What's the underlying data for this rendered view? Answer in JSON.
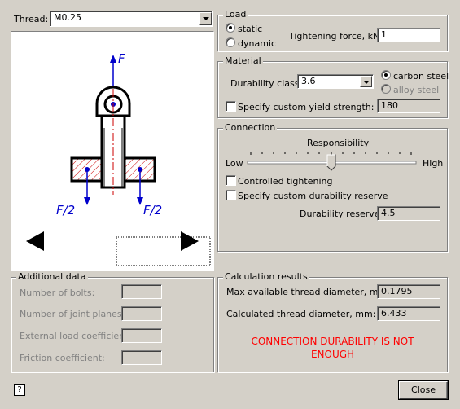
{
  "thread": {
    "label": "Thread:",
    "value": "M0.25"
  },
  "load": {
    "title": "Load",
    "static_label": "static",
    "dynamic_label": "dynamic",
    "selected": "static",
    "force_label": "Tightening force, kN:",
    "force_value": "1"
  },
  "material": {
    "title": "Material",
    "durability_label": "Durability class:",
    "durability_value": "3.6",
    "carbon_label": "carbon steel",
    "alloy_label": "alloy steel",
    "selected": "carbon steel",
    "yield_label": "Specify custom yield strength:",
    "yield_checked": false,
    "yield_value": "180"
  },
  "connection": {
    "title": "Connection",
    "responsibility_label": "Responsibility",
    "low_label": "Low",
    "high_label": "High",
    "controlled_label": "Controlled tightening",
    "controlled_checked": false,
    "reserve_check_label": "Specify custom durability reserve",
    "reserve_checked": false,
    "reserve_label": "Durability reserve:",
    "reserve_value": "4.5"
  },
  "diagram": {
    "force_top": "F",
    "force_left": "F/2",
    "force_right": "F/2",
    "force_color": "#0000cc",
    "hatch_color": "#cc0000"
  },
  "additional": {
    "title": "Additional data",
    "bolts_label": "Number of bolts:",
    "planes_label": "Number of joint planes:",
    "ext_label": "External load coefficient:",
    "friction_label": "Friction coefficient:"
  },
  "results": {
    "title": "Calculation results",
    "max_label": "Max available thread diameter, mm:",
    "max_value": "0.1795",
    "calc_label": "Calculated thread diameter, mm:",
    "calc_value": "6.433",
    "warning_line1": "CONNECTION DURABILITY IS NOT",
    "warning_line2": "ENOUGH",
    "warning_color": "#ff0000"
  },
  "footer": {
    "close_label": "Close",
    "help_icon": "help-icon"
  }
}
